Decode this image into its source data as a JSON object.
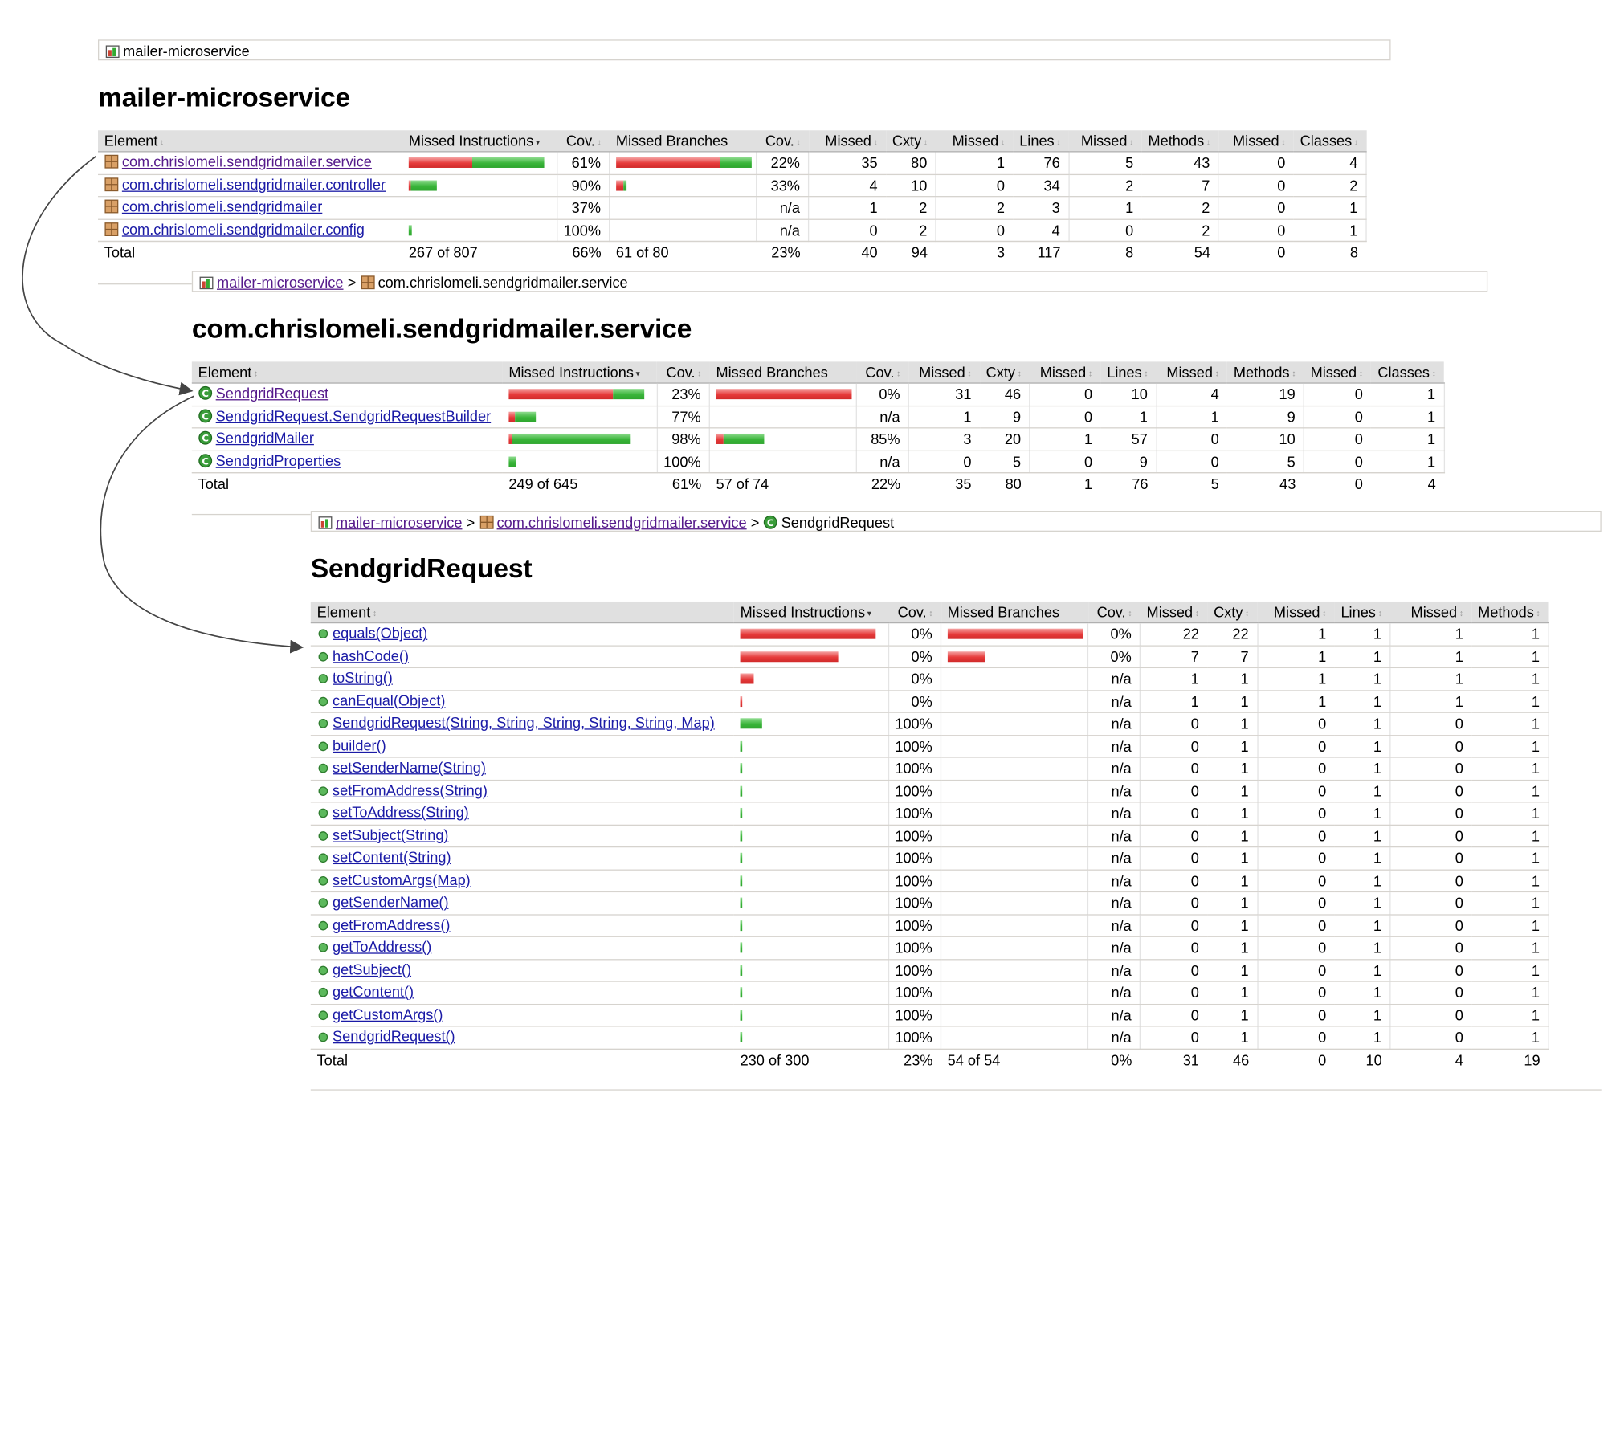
{
  "colors": {
    "missed_bar": "#e63b3b",
    "covered_bar": "#3ab53a",
    "header_bg": "#e0e0e0",
    "link": "#1a1aa6",
    "visited_link": "#551a8b"
  },
  "sort_icons": {
    "active": "▾",
    "inactive": "↕"
  },
  "project": {
    "breadcrumb": {
      "current": "mailer-microservice"
    },
    "title": "mailer-microservice",
    "headers": [
      "Element",
      "Missed Instructions",
      "Cov.",
      "Missed Branches",
      "Cov.",
      "Missed",
      "Cxty",
      "Missed",
      "Lines",
      "Missed",
      "Methods",
      "Missed",
      "Classes"
    ],
    "rows": [
      {
        "name": "com.chrislomeli.sendgridmailer.service",
        "icon": "package-icon",
        "instr": {
          "missed": 0.47,
          "covered": 0.53
        },
        "instr_cov": "61%",
        "br": {
          "missed": 0.77,
          "covered": 0.23
        },
        "br_cov": "22%",
        "cells": [
          "35",
          "80",
          "1",
          "76",
          "5",
          "43",
          "0",
          "4"
        ]
      },
      {
        "name": "com.chrislomeli.sendgridmailer.controller",
        "icon": "package-icon",
        "instr": {
          "missed": 0.01,
          "covered": 0.19
        },
        "instr_cov": "90%",
        "br": {
          "missed": 0.05,
          "covered": 0.025
        },
        "br_cov": "33%",
        "cells": [
          "4",
          "10",
          "0",
          "34",
          "2",
          "7",
          "0",
          "2"
        ]
      },
      {
        "name": "com.chrislomeli.sendgridmailer",
        "icon": "package-icon",
        "instr": {
          "missed": 0,
          "covered": 0
        },
        "instr_cov": "37%",
        "br": {
          "missed": 0,
          "covered": 0
        },
        "br_cov": "n/a",
        "cells": [
          "1",
          "2",
          "2",
          "3",
          "1",
          "2",
          "0",
          "1"
        ]
      },
      {
        "name": "com.chrislomeli.sendgridmailer.config",
        "icon": "package-icon",
        "instr": {
          "missed": 0,
          "covered": 0.02
        },
        "instr_cov": "100%",
        "br": {
          "missed": 0,
          "covered": 0
        },
        "br_cov": "n/a",
        "cells": [
          "0",
          "2",
          "0",
          "4",
          "0",
          "2",
          "0",
          "1"
        ]
      }
    ],
    "total": {
      "label": "Total",
      "instr": "267 of 807",
      "instr_cov": "66%",
      "br": "61 of 80",
      "br_cov": "23%",
      "cells": [
        "40",
        "94",
        "3",
        "117",
        "8",
        "54",
        "0",
        "8"
      ]
    }
  },
  "package": {
    "breadcrumb": {
      "root": "mailer-microservice",
      "sep": ">",
      "current": "com.chrislomeli.sendgridmailer.service"
    },
    "title": "com.chrislomeli.sendgridmailer.service",
    "headers": [
      "Element",
      "Missed Instructions",
      "Cov.",
      "Missed Branches",
      "Cov.",
      "Missed",
      "Cxty",
      "Missed",
      "Lines",
      "Missed",
      "Methods",
      "Missed",
      "Classes"
    ],
    "rows": [
      {
        "name": "SendgridRequest",
        "icon": "class-icon",
        "instr": {
          "missed": 0.77,
          "covered": 0.23
        },
        "instr_cov": "23%",
        "br": {
          "missed": 1.0,
          "covered": 0
        },
        "br_cov": "0%",
        "cells": [
          "31",
          "46",
          "0",
          "10",
          "4",
          "19",
          "0",
          "1"
        ]
      },
      {
        "name": "SendgridRequest.SendgridRequestBuilder",
        "icon": "class-icon",
        "instr": {
          "missed": 0.045,
          "covered": 0.155
        },
        "instr_cov": "77%",
        "br": {
          "missed": 0,
          "covered": 0
        },
        "br_cov": "n/a",
        "cells": [
          "1",
          "9",
          "0",
          "1",
          "1",
          "9",
          "0",
          "1"
        ]
      },
      {
        "name": "SendgridMailer",
        "icon": "class-icon",
        "instr": {
          "missed": 0.02,
          "covered": 0.88
        },
        "instr_cov": "98%",
        "br": {
          "missed": 0.055,
          "covered": 0.3
        },
        "br_cov": "85%",
        "cells": [
          "3",
          "20",
          "1",
          "57",
          "0",
          "10",
          "0",
          "1"
        ]
      },
      {
        "name": "SendgridProperties",
        "icon": "class-icon",
        "instr": {
          "missed": 0,
          "covered": 0.05
        },
        "instr_cov": "100%",
        "br": {
          "missed": 0,
          "covered": 0
        },
        "br_cov": "n/a",
        "cells": [
          "0",
          "5",
          "0",
          "9",
          "0",
          "5",
          "0",
          "1"
        ]
      }
    ],
    "total": {
      "label": "Total",
      "instr": "249 of 645",
      "instr_cov": "61%",
      "br": "57 of 74",
      "br_cov": "22%",
      "cells": [
        "35",
        "80",
        "1",
        "76",
        "5",
        "43",
        "0",
        "4"
      ]
    }
  },
  "class": {
    "breadcrumb": {
      "root": "mailer-microservice",
      "sep": ">",
      "package": "com.chrislomeli.sendgridmailer.service",
      "current": "SendgridRequest"
    },
    "title": "SendgridRequest",
    "headers": [
      "Element",
      "Missed Instructions",
      "Cov.",
      "Missed Branches",
      "Cov.",
      "Missed",
      "Cxty",
      "Missed",
      "Lines",
      "Missed",
      "Methods"
    ],
    "rows": [
      {
        "name": "equals(Object)",
        "instr": {
          "missed": 1.0,
          "covered": 0
        },
        "instr_cov": "0%",
        "br": {
          "missed": 1.0,
          "covered": 0
        },
        "br_cov": "0%",
        "cells": [
          "22",
          "22",
          "1",
          "1",
          "1",
          "1"
        ]
      },
      {
        "name": "hashCode()",
        "instr": {
          "missed": 0.72,
          "covered": 0
        },
        "instr_cov": "0%",
        "br": {
          "missed": 0.28,
          "covered": 0
        },
        "br_cov": "0%",
        "cells": [
          "7",
          "7",
          "1",
          "1",
          "1",
          "1"
        ]
      },
      {
        "name": "toString()",
        "instr": {
          "missed": 0.1,
          "covered": 0
        },
        "instr_cov": "0%",
        "br": {
          "missed": 0,
          "covered": 0
        },
        "br_cov": "n/a",
        "cells": [
          "1",
          "1",
          "1",
          "1",
          "1",
          "1"
        ]
      },
      {
        "name": "canEqual(Object)",
        "instr": {
          "missed": 0.01,
          "covered": 0
        },
        "instr_cov": "0%",
        "br": {
          "missed": 0,
          "covered": 0
        },
        "br_cov": "n/a",
        "cells": [
          "1",
          "1",
          "1",
          "1",
          "1",
          "1"
        ]
      },
      {
        "name": "SendgridRequest(String, String, String, String, String, Map)",
        "instr": {
          "missed": 0,
          "covered": 0.16
        },
        "instr_cov": "100%",
        "br": {
          "missed": 0,
          "covered": 0
        },
        "br_cov": "n/a",
        "cells": [
          "0",
          "1",
          "0",
          "1",
          "0",
          "1"
        ]
      },
      {
        "name": "builder()",
        "instr": {
          "missed": 0,
          "covered": 0.015
        },
        "instr_cov": "100%",
        "br": {
          "missed": 0,
          "covered": 0
        },
        "br_cov": "n/a",
        "cells": [
          "0",
          "1",
          "0",
          "1",
          "0",
          "1"
        ]
      },
      {
        "name": "setSenderName(String)",
        "instr": {
          "missed": 0,
          "covered": 0.015
        },
        "instr_cov": "100%",
        "br": {
          "missed": 0,
          "covered": 0
        },
        "br_cov": "n/a",
        "cells": [
          "0",
          "1",
          "0",
          "1",
          "0",
          "1"
        ]
      },
      {
        "name": "setFromAddress(String)",
        "instr": {
          "missed": 0,
          "covered": 0.015
        },
        "instr_cov": "100%",
        "br": {
          "missed": 0,
          "covered": 0
        },
        "br_cov": "n/a",
        "cells": [
          "0",
          "1",
          "0",
          "1",
          "0",
          "1"
        ]
      },
      {
        "name": "setToAddress(String)",
        "instr": {
          "missed": 0,
          "covered": 0.015
        },
        "instr_cov": "100%",
        "br": {
          "missed": 0,
          "covered": 0
        },
        "br_cov": "n/a",
        "cells": [
          "0",
          "1",
          "0",
          "1",
          "0",
          "1"
        ]
      },
      {
        "name": "setSubject(String)",
        "instr": {
          "missed": 0,
          "covered": 0.015
        },
        "instr_cov": "100%",
        "br": {
          "missed": 0,
          "covered": 0
        },
        "br_cov": "n/a",
        "cells": [
          "0",
          "1",
          "0",
          "1",
          "0",
          "1"
        ]
      },
      {
        "name": "setContent(String)",
        "instr": {
          "missed": 0,
          "covered": 0.015
        },
        "instr_cov": "100%",
        "br": {
          "missed": 0,
          "covered": 0
        },
        "br_cov": "n/a",
        "cells": [
          "0",
          "1",
          "0",
          "1",
          "0",
          "1"
        ]
      },
      {
        "name": "setCustomArgs(Map)",
        "instr": {
          "missed": 0,
          "covered": 0.015
        },
        "instr_cov": "100%",
        "br": {
          "missed": 0,
          "covered": 0
        },
        "br_cov": "n/a",
        "cells": [
          "0",
          "1",
          "0",
          "1",
          "0",
          "1"
        ]
      },
      {
        "name": "getSenderName()",
        "instr": {
          "missed": 0,
          "covered": 0.01
        },
        "instr_cov": "100%",
        "br": {
          "missed": 0,
          "covered": 0
        },
        "br_cov": "n/a",
        "cells": [
          "0",
          "1",
          "0",
          "1",
          "0",
          "1"
        ]
      },
      {
        "name": "getFromAddress()",
        "instr": {
          "missed": 0,
          "covered": 0.01
        },
        "instr_cov": "100%",
        "br": {
          "missed": 0,
          "covered": 0
        },
        "br_cov": "n/a",
        "cells": [
          "0",
          "1",
          "0",
          "1",
          "0",
          "1"
        ]
      },
      {
        "name": "getToAddress()",
        "instr": {
          "missed": 0,
          "covered": 0.01
        },
        "instr_cov": "100%",
        "br": {
          "missed": 0,
          "covered": 0
        },
        "br_cov": "n/a",
        "cells": [
          "0",
          "1",
          "0",
          "1",
          "0",
          "1"
        ]
      },
      {
        "name": "getSubject()",
        "instr": {
          "missed": 0,
          "covered": 0.01
        },
        "instr_cov": "100%",
        "br": {
          "missed": 0,
          "covered": 0
        },
        "br_cov": "n/a",
        "cells": [
          "0",
          "1",
          "0",
          "1",
          "0",
          "1"
        ]
      },
      {
        "name": "getContent()",
        "instr": {
          "missed": 0,
          "covered": 0.01
        },
        "instr_cov": "100%",
        "br": {
          "missed": 0,
          "covered": 0
        },
        "br_cov": "n/a",
        "cells": [
          "0",
          "1",
          "0",
          "1",
          "0",
          "1"
        ]
      },
      {
        "name": "getCustomArgs()",
        "instr": {
          "missed": 0,
          "covered": 0.01
        },
        "instr_cov": "100%",
        "br": {
          "missed": 0,
          "covered": 0
        },
        "br_cov": "n/a",
        "cells": [
          "0",
          "1",
          "0",
          "1",
          "0",
          "1"
        ]
      },
      {
        "name": "SendgridRequest()",
        "instr": {
          "missed": 0,
          "covered": 0.01
        },
        "instr_cov": "100%",
        "br": {
          "missed": 0,
          "covered": 0
        },
        "br_cov": "n/a",
        "cells": [
          "0",
          "1",
          "0",
          "1",
          "0",
          "1"
        ]
      }
    ],
    "total": {
      "label": "Total",
      "instr": "230 of 300",
      "instr_cov": "23%",
      "br": "54 of 54",
      "br_cov": "0%",
      "cells": [
        "31",
        "46",
        "0",
        "10",
        "4",
        "19"
      ]
    }
  }
}
